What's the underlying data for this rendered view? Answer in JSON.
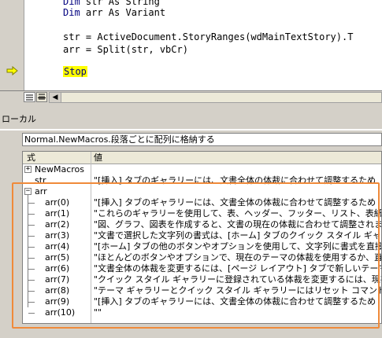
{
  "editor": {
    "lines": [
      {
        "keyword": "Dim",
        "rest": " str As String"
      },
      {
        "keyword": "Dim",
        "rest": " arr As Variant"
      },
      {
        "keyword": "",
        "rest": ""
      },
      {
        "keyword": "",
        "rest": "str = ActiveDocument.StoryRanges(wdMainTextStory).T"
      },
      {
        "keyword": "",
        "rest": "arr = Split(str, vbCr)"
      },
      {
        "keyword": "",
        "rest": ""
      },
      {
        "keyword": "Stop",
        "rest": ""
      }
    ],
    "scroll_left_glyph": "◀"
  },
  "locals": {
    "title": "ローカル",
    "context": "Normal.NewMacros.段落ごとに配列に格納する",
    "col_expression": "式",
    "col_value": "値",
    "newmacros_label": "NewMacros",
    "str_row": {
      "name": "str",
      "value": "\"[挿入] タブのギャラリーには、文書全体の体裁に合わせて調整するため"
    },
    "arr_label": "arr",
    "arr_items": [
      {
        "name": "arr(0)",
        "value": "\"[挿入] タブのギャラリーには、文書全体の体裁に合わせて調整するため"
      },
      {
        "name": "arr(1)",
        "value": "\"これらのギャラリーを使用して、表、ヘッダー、フッター、リスト、表紙や、"
      },
      {
        "name": "arr(2)",
        "value": "\"図、グラフ、図表を作成すると、文書の現在の体裁に合わせて調整されま"
      },
      {
        "name": "arr(3)",
        "value": "\"文書で選択した文字列の書式は、[ホーム] タブのクイック スタイル ギャラ"
      },
      {
        "name": "arr(4)",
        "value": "\"[ホーム] タブの他のボタンやオプションを使用して、文字列に書式を直接"
      },
      {
        "name": "arr(5)",
        "value": "\"ほとんどのボタンやオプションで、現在のテーマの体裁を使用するか、直接"
      },
      {
        "name": "arr(6)",
        "value": "\"文書全体の体裁を変更するには、[ページ レイアウト] タブで新しいテーマ"
      },
      {
        "name": "arr(7)",
        "value": "\"クイック スタイル ギャラリーに登録されている体裁を変更するには、現在の"
      },
      {
        "name": "arr(8)",
        "value": "\"テーマ ギャラリーとクイック スタイル ギャラリーにはリセット コマンドが用意"
      },
      {
        "name": "arr(9)",
        "value": "\"[挿入] タブのギャラリーには、文書全体の体裁に合わせて調整するため"
      },
      {
        "name": "arr(10)",
        "value": "\"\""
      }
    ],
    "expand_plus": "+",
    "expand_minus": "−"
  },
  "colors": {
    "highlight": "#f08a3a",
    "breakpoint_arrow": "#ffff00"
  }
}
